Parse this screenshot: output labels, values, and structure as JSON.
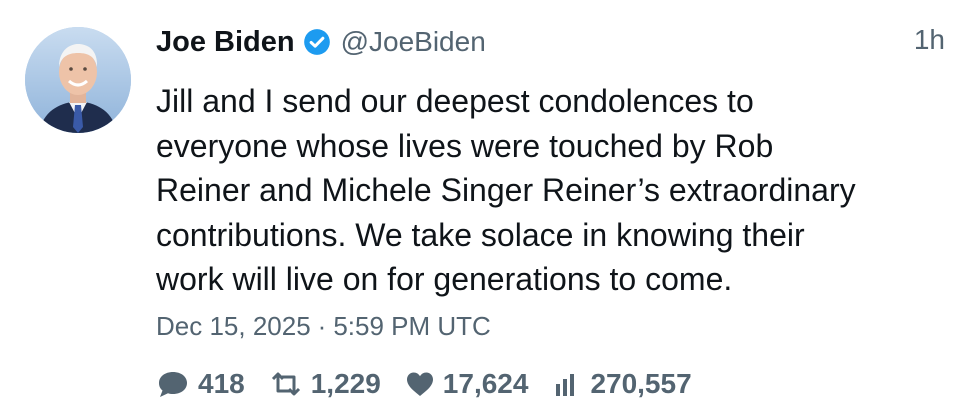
{
  "tweet": {
    "author": {
      "display_name": "Joe Biden",
      "handle": "@JoeBiden",
      "verified": true,
      "avatar_icon": "profile-photo"
    },
    "relative_time": "1h",
    "text": "Jill and I send our deepest condolences to\neveryone whose lives were touched by Rob\nReiner and Michele Singer Reiner’s extraordinary\ncontributions. We take solace in knowing their\nwork will live on for generations to come.",
    "date": "Dec 15, 2025",
    "separator": "·",
    "time": "5:59 PM UTC",
    "stats": {
      "replies": "418",
      "retweets": "1,229",
      "likes": "17,624",
      "views": "270,557"
    }
  },
  "colors": {
    "text": "#0f1419",
    "secondary": "#536471",
    "verified_badge": "#1d9bf0",
    "background": "#ffffff"
  }
}
